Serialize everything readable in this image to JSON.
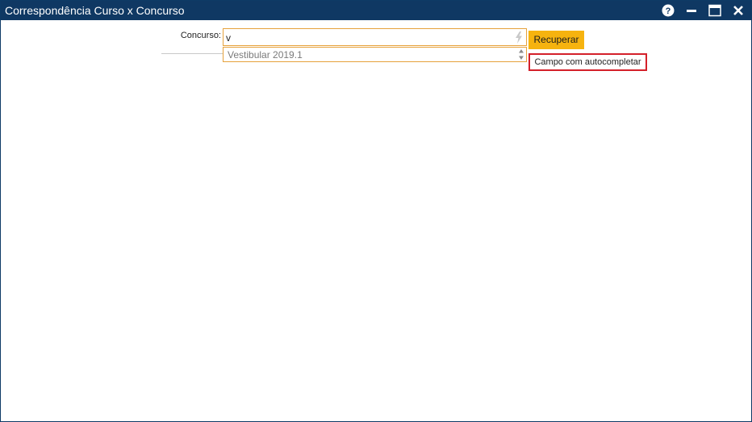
{
  "window": {
    "title": "Correspondência Curso x Concurso",
    "buttons": {
      "help_icon": "help-circle-icon",
      "minimize_icon": "minimize-icon",
      "maximize_icon": "maximize-icon",
      "close_icon": "close-icon"
    },
    "colors": {
      "titlebar": "#0f3863",
      "accent": "#f6b30f",
      "field_border": "#e6a23c",
      "tooltip_border": "#d4202a"
    }
  },
  "form": {
    "concurso_label": "Concurso:",
    "concurso_value": "v",
    "autocomplete_icon": "lightning-bolt-icon",
    "suggestions": [
      "Vestibular 2019.1"
    ],
    "recuperar_label": "Recuperar",
    "tooltip": "Campo com autocompletar"
  }
}
